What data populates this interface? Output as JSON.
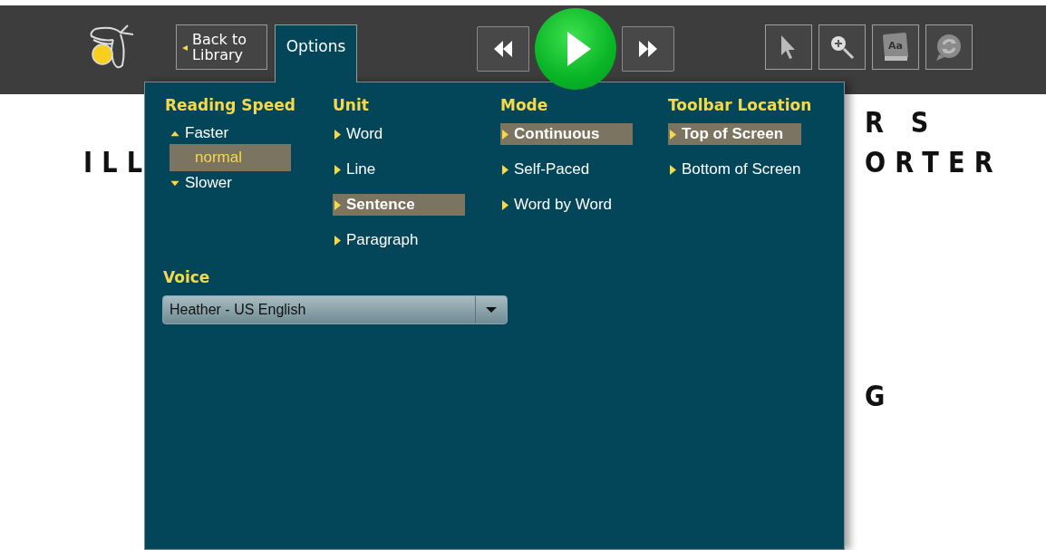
{
  "toolbar": {
    "back_button": {
      "arrow": "◂",
      "label": "Back to Library"
    },
    "tabs": [
      {
        "label": "Options",
        "selected": true
      }
    ],
    "tools": [
      {
        "kind": "pointer"
      },
      {
        "kind": "zoom"
      },
      {
        "kind": "dictionary",
        "label": "Aa"
      },
      {
        "kind": "sync"
      }
    ]
  },
  "page_text": {
    "left": [
      "ILL"
    ],
    "right": [
      "R S",
      "ORTER",
      "G"
    ]
  },
  "options_panel": {
    "columns": [
      {
        "heading": "Reading Speed",
        "kind": "speed",
        "items": [
          {
            "kind": "up",
            "label": "Faster"
          },
          {
            "kind": "value",
            "label": "normal"
          },
          {
            "kind": "down",
            "label": "Slower"
          }
        ]
      },
      {
        "heading": "Unit",
        "kind": "choice",
        "items": [
          {
            "label": "Word",
            "selected": false
          },
          {
            "label": "Line",
            "selected": false
          },
          {
            "label": "Sentence",
            "selected": true
          },
          {
            "label": "Paragraph",
            "selected": false
          }
        ]
      },
      {
        "heading": "Mode",
        "kind": "choice",
        "items": [
          {
            "label": "Continuous",
            "selected": true
          },
          {
            "label": "Self-Paced",
            "selected": false
          },
          {
            "label": "Word by Word",
            "selected": false
          }
        ]
      },
      {
        "heading": "Toolbar Location",
        "kind": "choice",
        "items": [
          {
            "label": "Top of Screen",
            "selected": true
          },
          {
            "label": "Bottom of Screen",
            "selected": false
          }
        ]
      }
    ],
    "voice": {
      "heading": "Voice",
      "value": "Heather - US English"
    }
  }
}
